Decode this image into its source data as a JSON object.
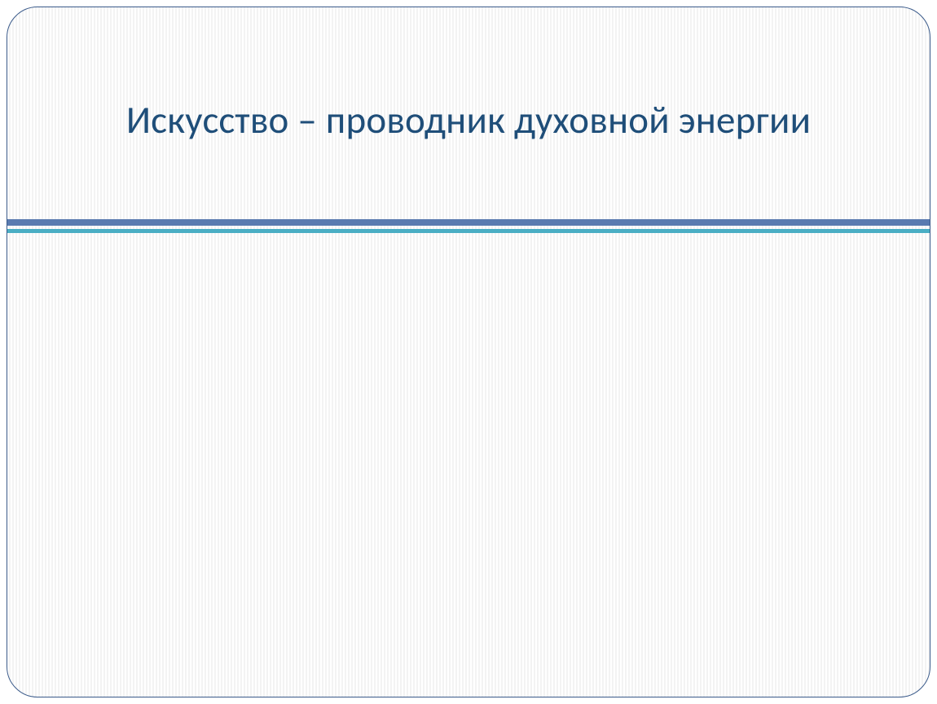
{
  "slide": {
    "title": "Искусство – проводник духовной энергии"
  },
  "theme": {
    "title_color": "#1f4e79",
    "border_color": "#3a5a8a",
    "divider_primary": "#5a7bb0",
    "divider_secondary": "#4aaec4"
  }
}
